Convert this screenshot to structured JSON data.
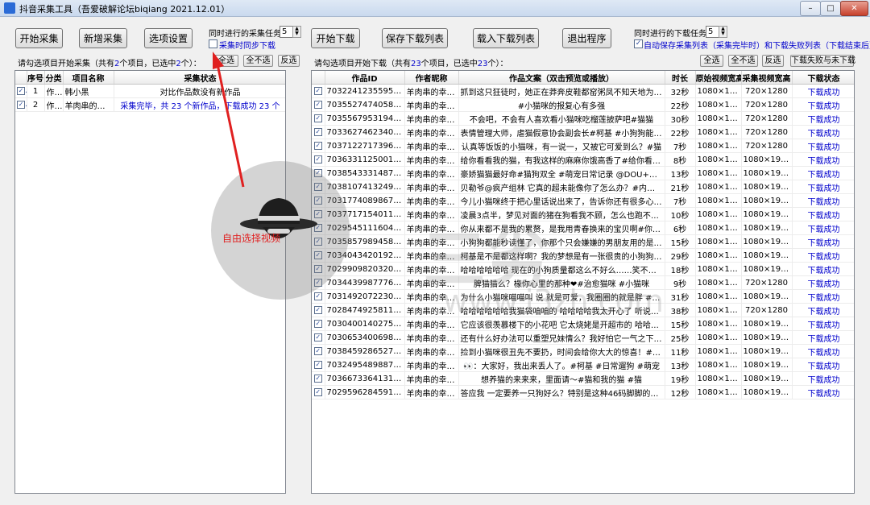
{
  "window": {
    "title": "抖音采集工具（吾爱破解论坛biqiang 2021.12.01）",
    "minimize": "–",
    "maximize": "□",
    "close": "✕"
  },
  "toolbar_left": {
    "start": "开始采集",
    "add": "新增采集",
    "options": "选项设置",
    "task_label": "同时进行的采集任务数",
    "task_value": "5",
    "sync_download": "采集时同步下载"
  },
  "toolbar_right": {
    "start": "开始下载",
    "save": "保存下载列表",
    "load": "载入下载列表",
    "exit": "退出程序",
    "task_label": "同时进行的下载任务数",
    "task_value": "5",
    "auto_save": "自动保存采集列表（采集完毕时）和下载失败列表（下载结束后）"
  },
  "left_list": {
    "hint_pre": "请勾选项目开始采集（共有",
    "total": "2",
    "hint_mid": "个项目，已选中",
    "selected": "2",
    "hint_post": "个）：",
    "btn_select_all": "全选",
    "btn_unselect_all": "全不选",
    "btn_invert": "反选",
    "columns": [
      "序号",
      "分类",
      "项目名称",
      "采集状态"
    ],
    "rows": [
      {
        "checked": true,
        "no": "1",
        "category": "作者",
        "name": "韩小黑",
        "status": "对比作品数没有新作品"
      },
      {
        "checked": true,
        "no": "2",
        "category": "作者",
        "name": "羊肉串的幸福…",
        "status": "采集完毕，共 23 个新作品，下载成功 23 个"
      }
    ]
  },
  "right_list": {
    "hint_pre": "请勾选项目开始下载（共有",
    "total": "23",
    "hint_mid": "个项目，已选中",
    "selected": "23",
    "hint_post": "个）：",
    "btn_select_all": "全选",
    "btn_unselect_all": "全不选",
    "btn_invert": "反选",
    "btn_fail_unfinished": "下载失败与未下载",
    "columns": [
      "作品ID",
      "作者昵称",
      "作品文案（双击预览或播放）",
      "时长",
      "原始视频宽高",
      "采集视频宽高",
      "下载状态"
    ],
    "rows": [
      {
        "id": "7032241235595185422",
        "author": "羊肉串的幸福…",
        "caption": "抓到这只狂徒时，她正在莽奔皮鞋都窑粥凤不知天地为何物#她…",
        "duration": "32秒",
        "orig": "1080×1920",
        "cap": "720×1280",
        "status": "下载成功"
      },
      {
        "id": "7035527474058398990",
        "author": "羊肉串的幸福…",
        "caption": "#小猫咪的报复心有多强",
        "duration": "22秒",
        "orig": "1080×1920",
        "cap": "720×1280",
        "status": "下载成功"
      },
      {
        "id": "7035567953194093855",
        "author": "羊肉串的幸福…",
        "caption": "不会吧，不会有人喜欢看小猫咪吃榴莲披萨吧#猫猫",
        "duration": "30秒",
        "orig": "1080×1920",
        "cap": "720×1280",
        "status": "下载成功"
      },
      {
        "id": "7033627462340857101",
        "author": "羊肉串的幸福…",
        "caption": "表情管理大师，虐猫假意协会副会长#柯基 #小狗狗能有什么坏…",
        "duration": "22秒",
        "orig": "1080×1920",
        "cap": "720×1280",
        "status": "下载成功"
      },
      {
        "id": "7037122717396536590",
        "author": "羊肉串的幸福…",
        "caption": "认真等饭饭的小猫咪，有一说一，又被它可爱到么？#猫",
        "duration": "7秒",
        "orig": "1080×1920",
        "cap": "720×1280",
        "status": "下载成功"
      },
      {
        "id": "7036331125001800990",
        "author": "羊肉串的幸福…",
        "caption": "给你看看我的猫，有我这样的麻麻你饿高香了#给你看看我的猫",
        "duration": "8秒",
        "orig": "1080×1920",
        "cap": "1080×1920",
        "status": "下载成功"
      },
      {
        "id": "7038543331487534350",
        "author": "羊肉串的幸福…",
        "caption": "豪娇猫猫最好命#猫狗双全 #萌宠日常记录 @DOU+小助手 @DOU…",
        "duration": "13秒",
        "orig": "1080×1920",
        "cap": "1080×1920",
        "status": "下载成功"
      },
      {
        "id": "7038107413249150239",
        "author": "羊肉串的幸福…",
        "caption": "贝勒爷@疯产组林  它真的超未能像你了怎么办？#内容太过真实",
        "duration": "21秒",
        "orig": "1080×1920",
        "cap": "1080×1920",
        "status": "下载成功"
      },
      {
        "id": "7031774089867145951",
        "author": "羊肉串的幸福…",
        "caption": "今儿小猫咪终于把心里话说出来了，告诉你还有很多心里话呢，#…",
        "duration": "7秒",
        "orig": "1080×1920",
        "cap": "1080×1920",
        "status": "下载成功"
      },
      {
        "id": "7037717154011041038",
        "author": "羊肉串的幸福…",
        "caption": "凌晨3点半，梦见对面的猪在狗看我不顾，怎么也跑不掉，结果…",
        "duration": "10秒",
        "orig": "1080×1920",
        "cap": "1080×1920",
        "status": "下载成功"
      },
      {
        "id": "7029545111604202783",
        "author": "羊肉串的幸福…",
        "caption": "你从来都不是我的累赘，是我用青春换来的宝贝啊#你从来都不…",
        "duration": "6秒",
        "orig": "1080×1920",
        "cap": "1080×1920",
        "status": "下载成功"
      },
      {
        "id": "7035857989458316581",
        "author": "羊肉串的幸福…",
        "caption": "小狗狗都能秒读懂了，你那个只会嫌嫌的男朋友用的是2G吧 @…",
        "duration": "15秒",
        "orig": "1080×1920",
        "cap": "1080×1920",
        "status": "下载成功"
      },
      {
        "id": "7034043420192656677",
        "author": "羊肉串的幸福…",
        "caption": "柯基是不是都这样啊？我的梦想是有一张很贵的小狗狗  ？#…",
        "duration": "29秒",
        "orig": "1080×1920",
        "cap": "1080×1920",
        "status": "下载成功"
      },
      {
        "id": "7029909820320674084",
        "author": "羊肉串的幸福…",
        "caption": "哈哈哈哈哈哈  现在的小狗质量都这么不好么……笑不活了哈哈…",
        "duration": "18秒",
        "orig": "1080×1920",
        "cap": "1080×1920",
        "status": "下载成功"
      },
      {
        "id": "7034439987776998686",
        "author": "羊肉串的幸福…",
        "caption": "脾猫猫么？椽你心里的那种❤#治愈猫咪 #小猫咪",
        "duration": "9秒",
        "orig": "1080×1920",
        "cap": "720×1280",
        "status": "下载成功"
      },
      {
        "id": "7031492072230306853",
        "author": "羊肉串的幸福…",
        "caption": "为什么小猫咪喵喵叫 说 就是可爱，我圈圈的就是胖 #创作灵感…",
        "duration": "31秒",
        "orig": "1080×1920",
        "cap": "1080×1920",
        "status": "下载成功"
      },
      {
        "id": "7028474925811780871",
        "author": "羊肉串的幸福…",
        "caption": "哈哈哈哈哈哈我猫袋咱咱的 哈哈哈哈我太开心了 听说吃耳…",
        "duration": "38秒",
        "orig": "1080×1920",
        "cap": "720×1280",
        "status": "下载成功"
      },
      {
        "id": "7030400140275879199",
        "author": "羊肉串的幸福…",
        "caption": "它应该很羡慕楼下的小花吧 它太烧姥是开超市的  哈哈哈哈哈哈…",
        "duration": "15秒",
        "orig": "1080×1920",
        "cap": "1080×1920",
        "status": "下载成功"
      },
      {
        "id": "7030653400698080519",
        "author": "羊肉串的幸福…",
        "caption": "还有什么好办法可以重塑兄妹情么？我好怕它一气之下把自己的…",
        "duration": "25秒",
        "orig": "1080×1920",
        "cap": "1080×1920",
        "status": "下载成功"
      },
      {
        "id": "7038459286527249671",
        "author": "羊肉串的幸福…",
        "caption": "捡到小猫咪很丑先不要扔，时间会给你大大的惊喜！#流浪猫逆…",
        "duration": "11秒",
        "orig": "1080×1920",
        "cap": "1080×1920",
        "status": "下载成功"
      },
      {
        "id": "7032495489887030565",
        "author": "羊肉串的幸福…",
        "caption": "👀：大家好，我出来丢人了。#柯基 #日常遛狗 #萌宠",
        "duration": "13秒",
        "orig": "1080×1920",
        "cap": "1080×1920",
        "status": "下载成功"
      },
      {
        "id": "7036673364131384590",
        "author": "羊肉串的幸福…",
        "caption": "想养猫的来来来，里面请～#猫和我的猫 #猫",
        "duration": "19秒",
        "orig": "1080×1920",
        "cap": "1080×1920",
        "status": "下载成功"
      },
      {
        "id": "7029596284591901959",
        "author": "羊肉串的幸福…",
        "caption": "答应我 一定要养一只狗好么？特别是这种46码脚脚的狗子 不…",
        "duration": "12秒",
        "orig": "1080×1920",
        "cap": "1080×1920",
        "status": "下载成功"
      }
    ]
  },
  "watermark": {
    "caption": "自由选择视频",
    "brand": "三劣",
    "url": "www.i3zh.com"
  },
  "colors": {
    "link": "#0000cc",
    "arrow": "#e02020"
  }
}
